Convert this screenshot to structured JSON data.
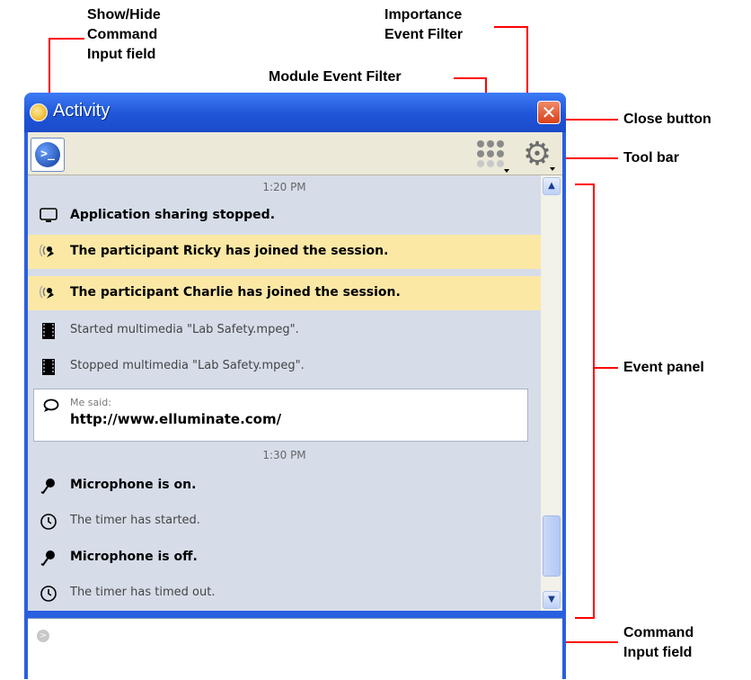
{
  "annotations": {
    "show_hide_cmd": [
      "Show/Hide",
      "Command",
      "Input field"
    ],
    "importance_filter": [
      "Importance",
      "Event Filter"
    ],
    "module_filter": "Module Event Filter",
    "close_button": "Close button",
    "tool_bar": "Tool bar",
    "event_panel": "Event panel",
    "command_input": [
      "Command",
      "Input field"
    ]
  },
  "window": {
    "title": "Activity",
    "close_glyph": "✕"
  },
  "toolbar": {
    "cmd_toggle_glyph": ">_"
  },
  "events": {
    "time1": "1:20 PM",
    "items1": [
      {
        "icon": "screen-icon",
        "text": "Application sharing stopped.",
        "style": "bold",
        "highlight": false
      },
      {
        "icon": "participant-icon",
        "text": "The participant Ricky has joined the session.",
        "style": "bold",
        "highlight": true
      },
      {
        "icon": "participant-icon",
        "text": "The participant Charlie has joined the session.",
        "style": "bold",
        "highlight": true
      },
      {
        "icon": "film-icon",
        "text": "Started multimedia \"Lab Safety.mpeg\".",
        "style": "normal",
        "highlight": false
      },
      {
        "icon": "film-icon",
        "text": "Stopped multimedia \"Lab Safety.mpeg\".",
        "style": "normal",
        "highlight": false
      }
    ],
    "chat": {
      "who": "Me said:",
      "message": "http://www.elluminate.com/"
    },
    "time2": "1:30 PM",
    "items2": [
      {
        "icon": "microphone-icon",
        "text": "Microphone is on.",
        "style": "bold"
      },
      {
        "icon": "timer-icon",
        "text": "The timer has started.",
        "style": "normal"
      },
      {
        "icon": "microphone-icon",
        "text": "Microphone is off.",
        "style": "bold"
      },
      {
        "icon": "timer-icon",
        "text": "The timer has timed out.",
        "style": "normal"
      }
    ]
  },
  "colors": {
    "titlebar": "#1f55d8",
    "highlight": "#fbe8a5",
    "panel": "#d6dde9",
    "callout": "#ff0000"
  },
  "command_input": {
    "value": "",
    "placeholder": ""
  }
}
